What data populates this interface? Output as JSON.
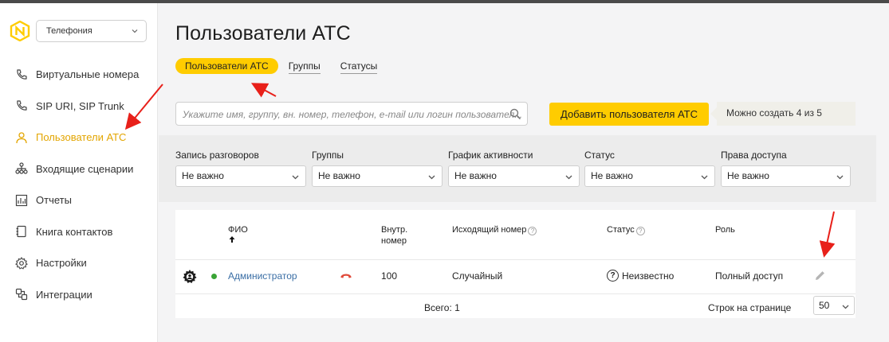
{
  "sidebar": {
    "product_select": "Телефония",
    "items": [
      {
        "label": "Виртуальные номера",
        "icon": "phone-icon"
      },
      {
        "label": "SIP URI, SIP Trunk",
        "icon": "phone-icon"
      },
      {
        "label": "Пользователи АТС",
        "icon": "user-icon",
        "active": true
      },
      {
        "label": "Входящие сценарии",
        "icon": "hierarchy-icon"
      },
      {
        "label": "Отчеты",
        "icon": "chart-icon"
      },
      {
        "label": "Книга контактов",
        "icon": "book-icon"
      },
      {
        "label": "Настройки",
        "icon": "gear-icon"
      },
      {
        "label": "Интеграции",
        "icon": "integration-icon"
      }
    ]
  },
  "main": {
    "title": "Пользователи АТС",
    "tabs": [
      {
        "label": "Пользователи АТС",
        "active": true
      },
      {
        "label": "Группы"
      },
      {
        "label": "Статусы"
      }
    ],
    "search": {
      "placeholder": "Укажите имя, группу, вн. номер, телефон, e-mail или логин пользовател..."
    },
    "add_button": "Добавить пользователя АТС",
    "quota": "Можно создать 4 из 5",
    "filters": [
      {
        "label": "Запись разговоров",
        "value": "Не важно"
      },
      {
        "label": "Группы",
        "value": "Не важно"
      },
      {
        "label": "График активности",
        "value": "Не важно"
      },
      {
        "label": "Статус",
        "value": "Не важно"
      },
      {
        "label": "Права доступа",
        "value": "Не важно"
      }
    ],
    "table": {
      "headers": {
        "name": "ФИО",
        "ext_line1": "Внутр.",
        "ext_line2": "номер",
        "outgoing": "Исходящий номер",
        "status": "Статус",
        "role": "Роль"
      },
      "rows": [
        {
          "name": "Администратор",
          "ext": "100",
          "outgoing": "Случайный",
          "status": "Неизвестно",
          "role": "Полный доступ"
        }
      ],
      "total": "Всего: 1",
      "rows_per_page_label": "Строк на странице",
      "rows_per_page": "50"
    }
  },
  "colors": {
    "accent": "#ffcc00",
    "active_text": "#e3a500",
    "link": "#3a6ea5",
    "online": "#3aa436",
    "annotation": "#e8201a"
  }
}
